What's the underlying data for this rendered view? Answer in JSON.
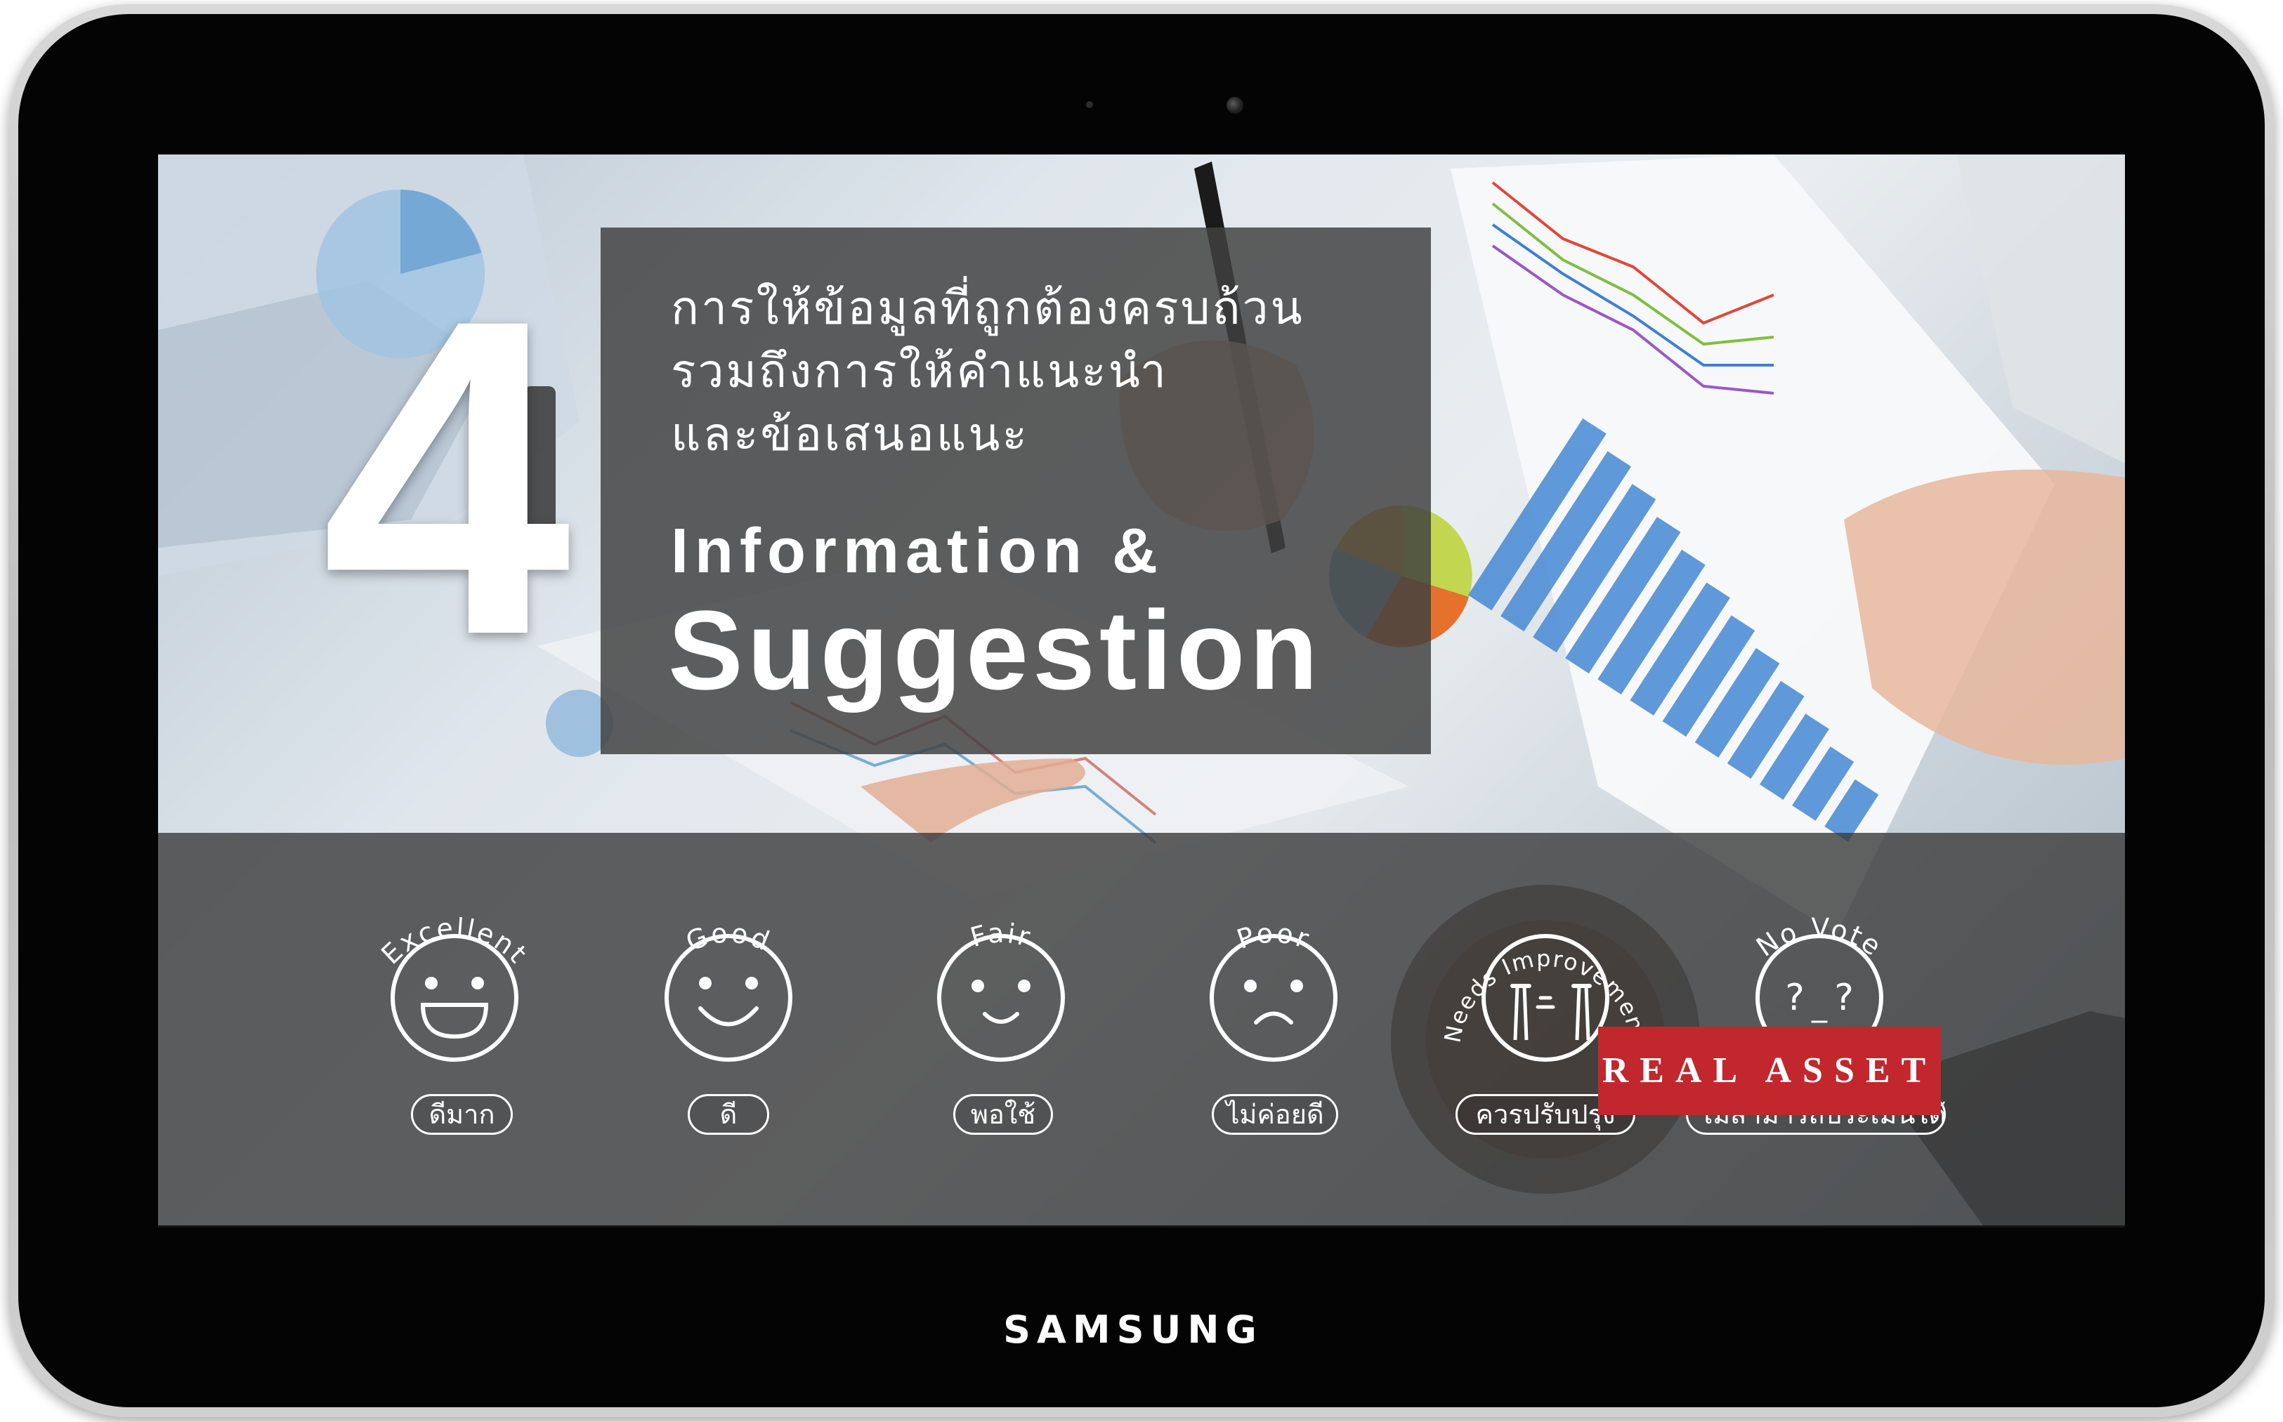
{
  "device": {
    "brand": "SAMSUNG"
  },
  "slide": {
    "number": "4",
    "thai_title_lines": [
      "การให้ข้อมูลที่ถูกต้องครบถ้วน",
      "รวมถึงการให้คำแนะนำ",
      "และข้อเสนอแนะ"
    ],
    "english_title_line1": "Information &",
    "english_title_line2": "Suggestion"
  },
  "ratings": [
    {
      "id": "excellent",
      "label_en": "Excellent",
      "label_th": "ดีมาก",
      "icon": "big-smile-face-icon"
    },
    {
      "id": "good",
      "label_en": "Good",
      "label_th": "ดี",
      "icon": "smile-face-icon"
    },
    {
      "id": "fair",
      "label_en": "Fair",
      "label_th": "พอใช้",
      "icon": "slight-smile-face-icon"
    },
    {
      "id": "poor",
      "label_en": "Poor",
      "label_th": "ไม่ค่อยดี",
      "icon": "frown-face-icon"
    },
    {
      "id": "needs-improvement",
      "label_en": "Needs Improvement",
      "label_th": "ควรปรับปรุง",
      "icon": "crying-face-icon"
    },
    {
      "id": "no-vote",
      "label_en": "No Vote",
      "label_th": "ไม่สามารถประเมินได้",
      "icon": "question-face-icon"
    }
  ],
  "logo": {
    "text": "REAL ASSET",
    "color": "#c1272d"
  }
}
